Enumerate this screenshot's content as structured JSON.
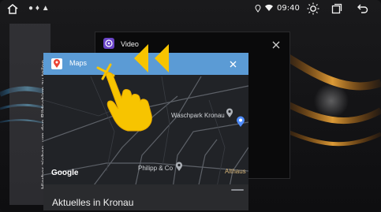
{
  "status_bar": {
    "time": "09:40"
  },
  "sidebar": {
    "hint": "Hierher ziehen, um den Bildschirm zu teilen"
  },
  "recents": {
    "video_card": {
      "title": "Video"
    },
    "maps_card": {
      "title": "Maps",
      "map_labels": {
        "poi1": "Waschpark Kronau",
        "poi2": "Philipp & Co",
        "poi3": "Althaus"
      },
      "attribution": "Google",
      "bottom_sheet_title": "Aktuelles in Kronau"
    }
  },
  "icons": {
    "home": "home-icon",
    "brightness": "brightness-icon",
    "recents": "recents-icon",
    "back": "back-icon",
    "wifi": "wifi-icon",
    "location": "location-icon"
  },
  "colors": {
    "maps_header": "#5b9bd5",
    "gesture_yellow": "#f7c400"
  }
}
